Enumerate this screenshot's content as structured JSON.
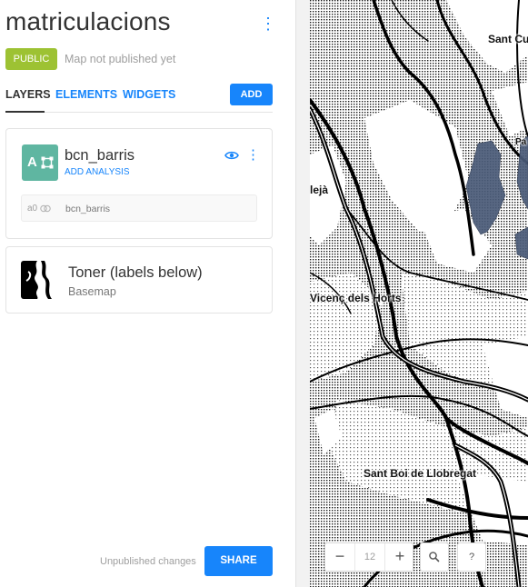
{
  "header": {
    "title": "matriculacions",
    "menu_icon": "more-vertical-icon",
    "privacy_badge": "PUBLIC",
    "publish_status": "Map not published yet",
    "colors": {
      "accent": "#1785fb",
      "public": "#9dc233"
    }
  },
  "tabs": {
    "items": [
      {
        "label": "LAYERS",
        "active": true
      },
      {
        "label": "ELEMENTS",
        "active": false
      },
      {
        "label": "WIDGETS",
        "active": false
      }
    ],
    "add_label": "ADD"
  },
  "layer": {
    "letter": "A",
    "name": "bcn_barris",
    "add_analysis": "ADD ANALYSIS",
    "thumb_color": "#5fb6a1",
    "source": {
      "id": "a0",
      "name": "bcn_barris"
    }
  },
  "basemap": {
    "name": "Toner (labels below)",
    "type": "Basemap"
  },
  "footer": {
    "unpublished": "Unpublished changes",
    "share_label": "SHARE"
  },
  "map": {
    "labels": {
      "sant_cugat": "Sant Cu",
      "molins": "lejà",
      "sant_vicenc": "Vicenç dels Horts",
      "sant_boi": "Sant Boi de Llobregat",
      "pa": "Pa"
    },
    "zoom": {
      "minus": "−",
      "level": "12",
      "plus": "+"
    },
    "help": "?",
    "polygon_color": "#4a5b78"
  }
}
